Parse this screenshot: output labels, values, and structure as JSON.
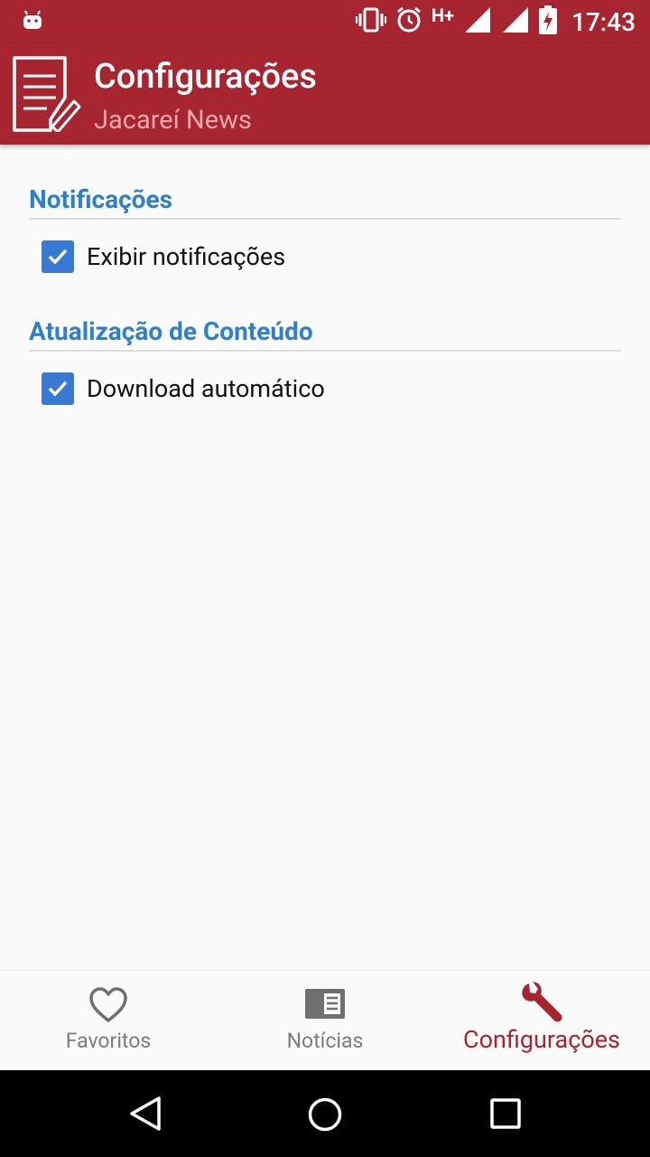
{
  "status_bar": {
    "time": "17:43",
    "network": "H+",
    "icons": [
      "android-icon",
      "vibrate-icon",
      "alarm-icon",
      "signal-icon",
      "signal-icon",
      "battery-charging-icon"
    ]
  },
  "app_bar": {
    "title": "Configurações",
    "subtitle": "Jacareí News",
    "logo_icon": "note-edit-icon",
    "color": "#a62530"
  },
  "settings": {
    "categories": [
      {
        "title": "Notificações",
        "items": [
          {
            "label": "Exibir notificações",
            "checked": true
          }
        ]
      },
      {
        "title": "Atualização de Conteúdo",
        "items": [
          {
            "label": "Download automático",
            "checked": true
          }
        ]
      }
    ],
    "accent_color": "#2f7fcc",
    "checkbox_color": "#3879d3"
  },
  "bottom_nav": {
    "items": [
      {
        "label": "Favoritos",
        "icon": "heart-icon",
        "active": false
      },
      {
        "label": "Notícias",
        "icon": "news-icon",
        "active": false
      },
      {
        "label": "Configurações",
        "icon": "wrench-icon",
        "active": true
      }
    ]
  },
  "system_nav": {
    "icons": [
      "back-icon",
      "home-icon",
      "recents-icon"
    ]
  }
}
